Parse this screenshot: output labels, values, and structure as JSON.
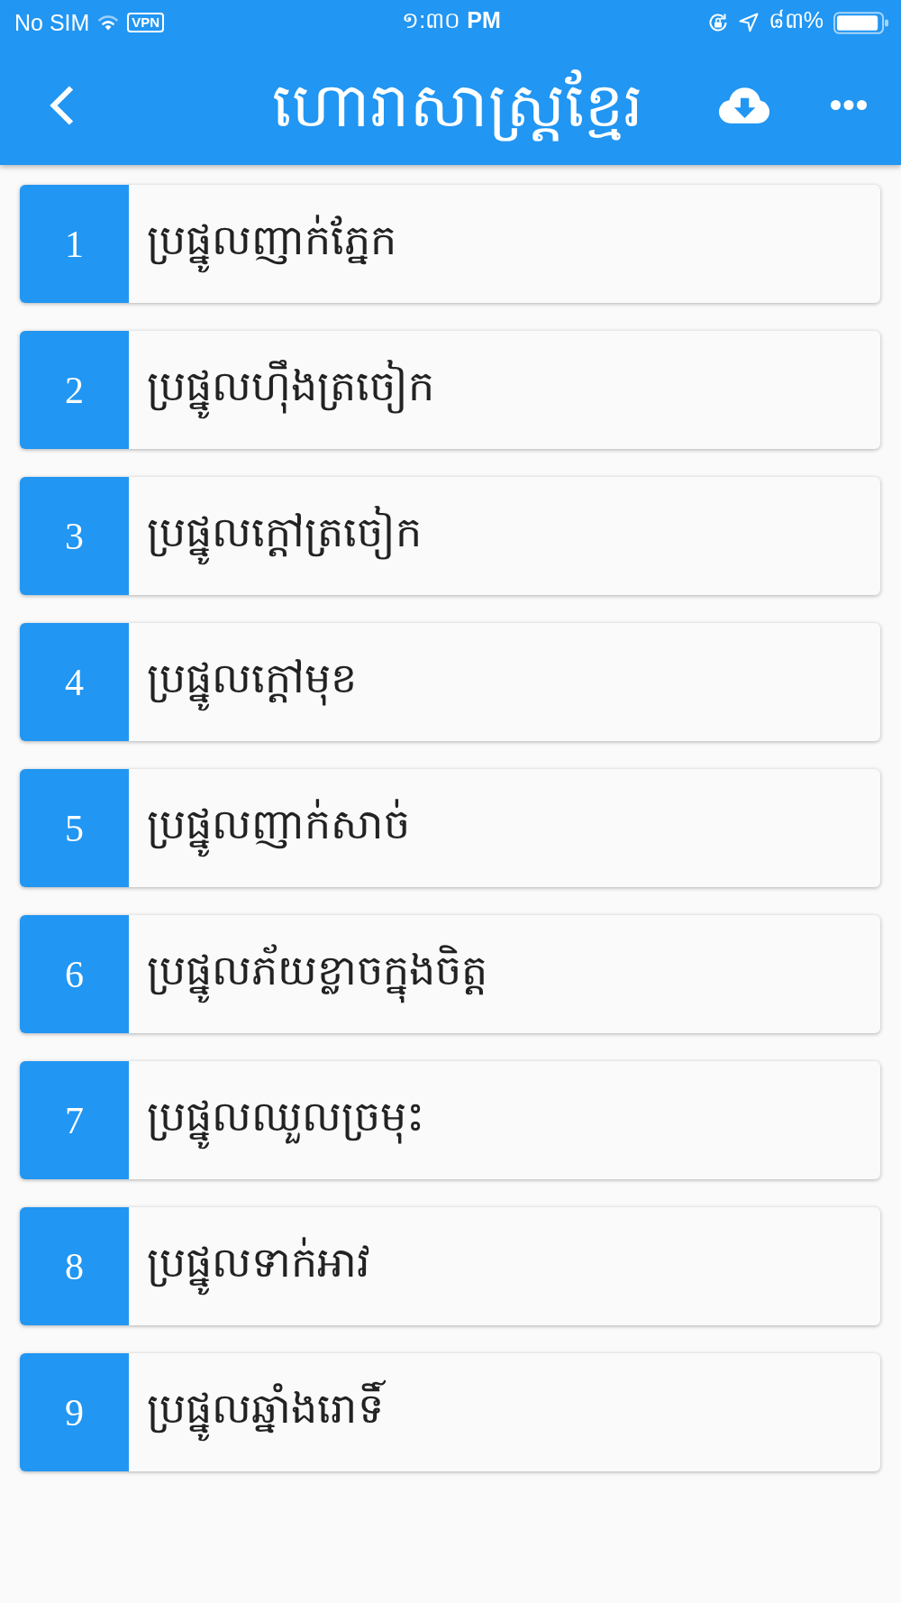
{
  "status_bar": {
    "carrier": "No SIM",
    "vpn": "VPN",
    "time": "១:៣០ **PM**",
    "battery": "៨៣%"
  },
  "nav_bar": {
    "title": "ហោរាសាស្ត្រខ្មែរ"
  },
  "items": [
    {
      "number": "1",
      "title": "ប្រផ្នូលញាក់ភ្នែក"
    },
    {
      "number": "2",
      "title": "ប្រផ្នូលហ៊ឹងត្រចៀក"
    },
    {
      "number": "3",
      "title": "ប្រផ្នូលក្តៅត្រចៀក"
    },
    {
      "number": "4",
      "title": "ប្រផ្នូលក្តៅមុខ"
    },
    {
      "number": "5",
      "title": "ប្រផ្នូលញាក់សាច់"
    },
    {
      "number": "6",
      "title": "ប្រផ្នូលភ័យខ្លាចក្នុងចិត្ត"
    },
    {
      "number": "7",
      "title": "ប្រផ្នូលឈួលច្រមុះ"
    },
    {
      "number": "8",
      "title": "ប្រផ្នូលទាក់អាវ"
    },
    {
      "number": "9",
      "title": "ប្រផ្នូលឆ្នាំងរោទិ៍"
    }
  ]
}
